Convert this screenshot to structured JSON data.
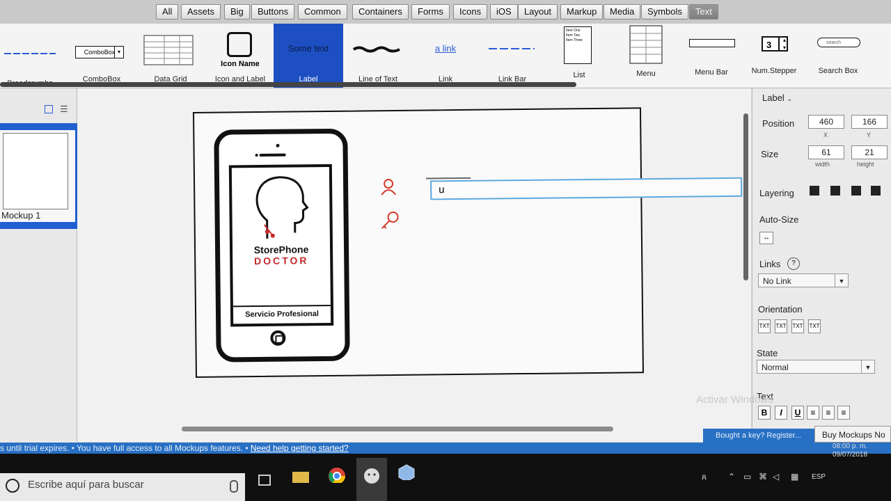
{
  "categories": {
    "tabs": [
      "All",
      "Assets",
      "Big",
      "Buttons",
      "Common",
      "Containers",
      "Forms",
      "Icons",
      "iOS",
      "Layout",
      "Markup",
      "Media",
      "Symbols",
      "Text"
    ],
    "active": "Text"
  },
  "components": {
    "items": [
      "Breadcrumbs",
      "ComboBox",
      "Data Grid",
      "Icon and Label",
      "Label",
      "Line of Text",
      "Link",
      "Link Bar",
      "List",
      "Menu",
      "Menu Bar",
      "Num.Stepper",
      "Search Box"
    ],
    "combobox_text": "ComboBox",
    "icon_name_text": "Icon Name",
    "label_preview": "Some text",
    "link_preview": "a link",
    "stepper_value": "3",
    "search_placeholder": "search",
    "list_preview": [
      "Item One",
      "Item Two",
      "Item Three"
    ]
  },
  "left_panel": {
    "mockup_name": "Mockup 1"
  },
  "canvas": {
    "brand_line1": "StorePhone",
    "brand_line2": "DOCTOR",
    "service_text": "Servicio Profesional",
    "textfield_value": "u"
  },
  "inspector": {
    "title": "Label",
    "position_label": "Position",
    "x": "460",
    "y": "166",
    "x_label": "X",
    "y_label": "Y",
    "size_label": "Size",
    "width": "61",
    "height": "21",
    "width_label": "width",
    "height_label": "height",
    "layering_label": "Layering",
    "autosize_label": "Auto-Size",
    "links_label": "Links",
    "links_value": "No Link",
    "orientation_label": "Orientation",
    "state_label": "State",
    "state_value": "Normal",
    "text_label": "Text",
    "activate_windows": "Activar Windows"
  },
  "trial_bar": {
    "message": "s until trial expires. • You have full access to all Mockups features. •",
    "help_link": "Need help getting started?",
    "bought_key": "Bought a key? Register...",
    "buy_button": "Buy Mockups No"
  },
  "taskbar": {
    "search_placeholder": "Escribe aquí para buscar",
    "language": "ESP",
    "time": "08:00 p. m.",
    "date": "09/07/2018"
  },
  "colors": {
    "selection_blue": "#1d4fc2",
    "trial_bar": "#2870c4",
    "brand_red": "#c42a2a",
    "field_border": "#5aa9dd"
  }
}
